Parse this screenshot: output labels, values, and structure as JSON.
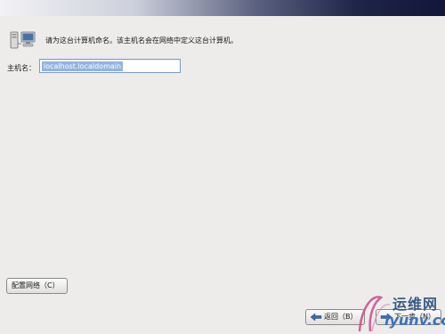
{
  "header": {
    "banner": ""
  },
  "intro": {
    "icon": "network-computer-icon",
    "text": "请为这台计算机命名。该主机名会在网络中定义这台计算机。"
  },
  "hostname": {
    "label": "主机名：",
    "value": "localhost.localdomain"
  },
  "buttons": {
    "configure_network": "配置网络（C）",
    "back": "返回（B）",
    "next": "下一步（N）",
    "back_icon": "arrow-left-icon",
    "next_icon": "arrow-right-icon"
  },
  "watermark": {
    "brand_cn": "运维网",
    "brand_en": "iyunv.com"
  },
  "colors": {
    "background": "#edeceb",
    "selection": "#92b4e0",
    "input_border": "#7a9cc6",
    "banner_dark": "#11163a"
  }
}
